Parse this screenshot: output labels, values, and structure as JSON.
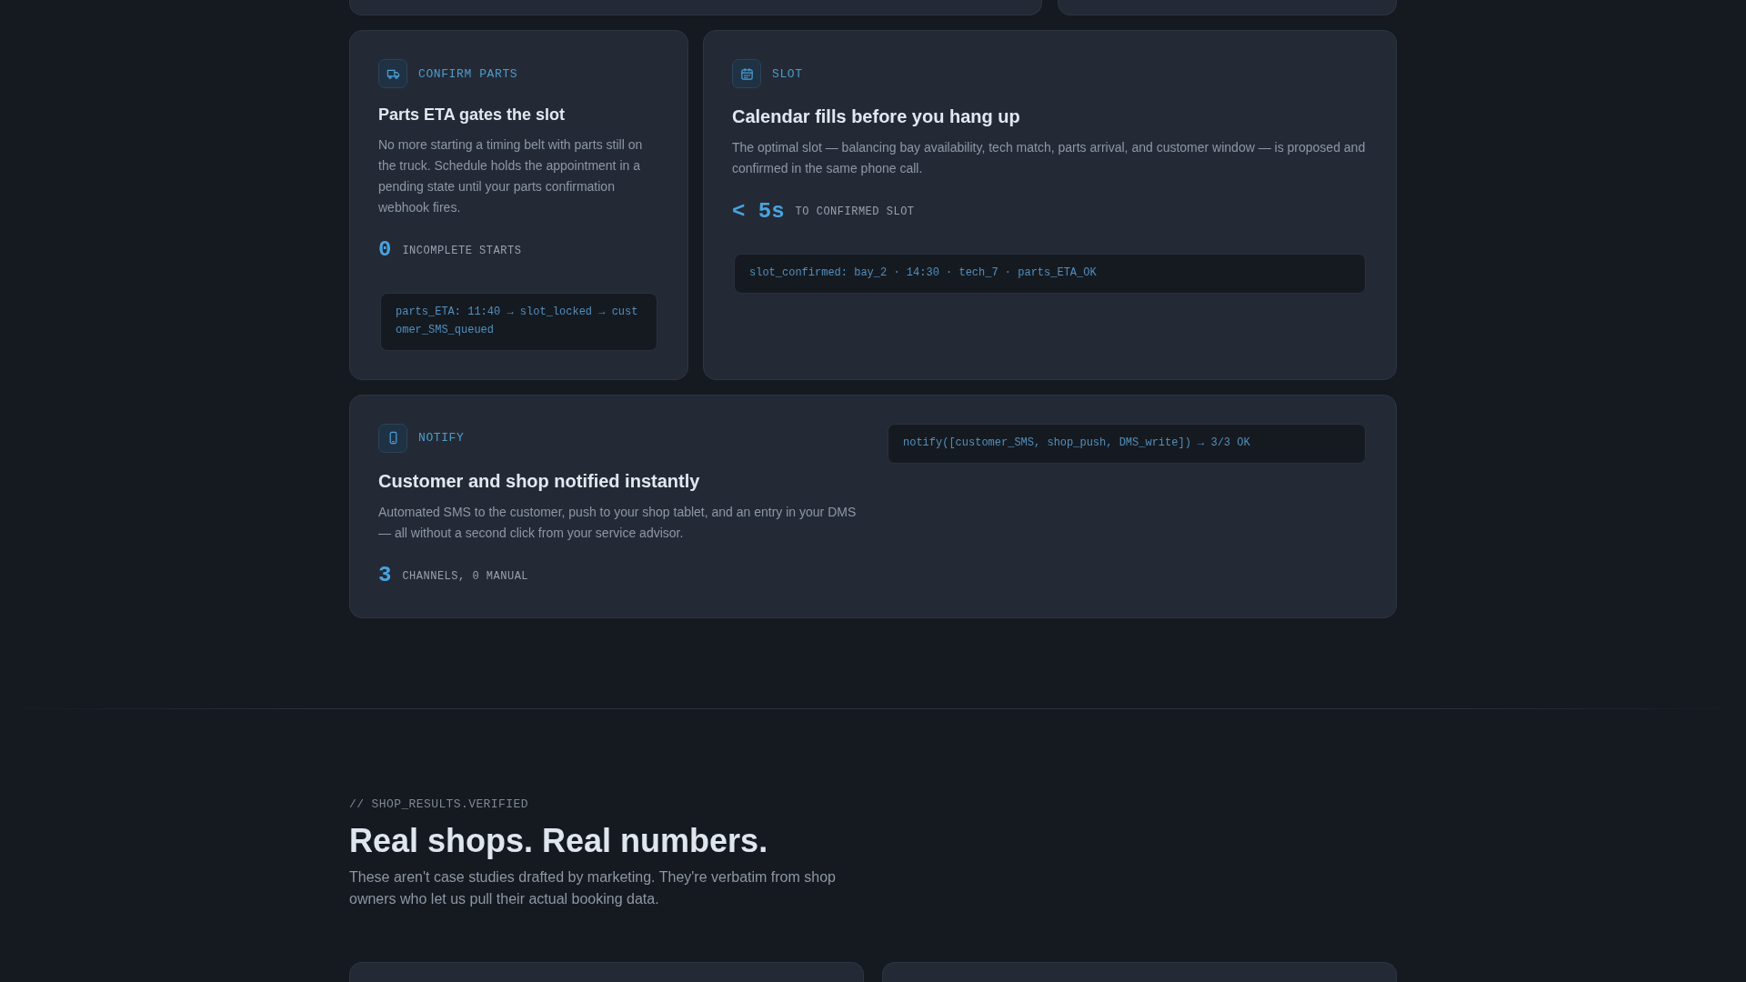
{
  "features": [
    {
      "kind": "narrow",
      "step": "CONFIRM PARTS",
      "title": "Parts ETA gates the slot",
      "body": "No more starting a timing belt with parts still on the truck. Schedule holds the appointment in a pending state until your parts confirmation webhook fires.",
      "stat": {
        "value": "0",
        "label": "INCOMPLETE STARTS"
      },
      "code": "parts_ETA: 11:40 → slot_locked → customer_SMS_queued"
    },
    {
      "kind": "wide",
      "step": "SLOT",
      "title": "Calendar fills before you hang up",
      "body": "The optimal slot — balancing bay availability, tech match, parts arrival, and customer window — is proposed and confirmed in the same phone call.",
      "stat": {
        "value": "< 5s",
        "label": "TO CONFIRMED SLOT"
      },
      "code": "slot_confirmed: bay_2 · 14:30 · tech_7 · parts_ETA_OK"
    },
    {
      "kind": "split",
      "step": "NOTIFY",
      "title": "Customer and shop notified instantly",
      "body": "Automated SMS to the customer, push to your shop tablet, and an entry in your DMS — all without a second click from your service advisor.",
      "stat": {
        "value": "3",
        "label": "CHANNELS, 0 MANUAL"
      },
      "code": "notify([customer_SMS, shop_push, DMS_write]) → 3/3 OK"
    }
  ],
  "results_section": {
    "eyebrow": "// SHOP_RESULTS.VERIFIED",
    "title": "Real shops. Real numbers.",
    "description": "These aren't case studies drafted by marketing. They're verbatim from shop owners who let us pull their actual booking data."
  }
}
